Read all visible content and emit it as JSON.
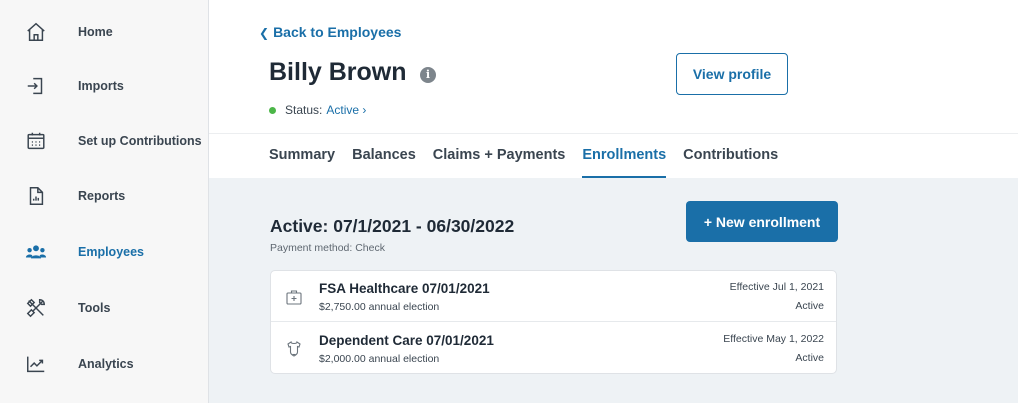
{
  "sidebar": {
    "items": [
      {
        "label": "Home",
        "icon": "home-icon"
      },
      {
        "label": "Imports",
        "icon": "import-icon"
      },
      {
        "label": "Set up Contributions",
        "icon": "calendar-icon"
      },
      {
        "label": "Reports",
        "icon": "report-document-icon"
      },
      {
        "label": "Employees",
        "icon": "people-icon",
        "active": true
      },
      {
        "label": "Tools",
        "icon": "tools-icon"
      },
      {
        "label": "Analytics",
        "icon": "analytics-icon"
      }
    ]
  },
  "header": {
    "back_label": "Back to Employees",
    "employee_name": "Billy Brown",
    "status_prefix": "Status:",
    "status_value": "Active ›",
    "view_profile_label": "View profile",
    "tabs": [
      {
        "label": "Summary"
      },
      {
        "label": "Balances"
      },
      {
        "label": "Claims + Payments"
      },
      {
        "label": "Enrollments",
        "active": true
      },
      {
        "label": "Contributions"
      }
    ]
  },
  "main": {
    "period_title": "Active: 07/1/2021 - 06/30/2022",
    "payment_method": "Payment method: Check",
    "new_enrollment_label": "+ New enrollment",
    "enrollments": [
      {
        "title": "FSA Healthcare 07/01/2021",
        "election": "$2,750.00 annual election",
        "effective": "Effective Jul 1, 2021",
        "status": "Active",
        "icon": "first-aid-kit-icon"
      },
      {
        "title": "Dependent Care 07/01/2021",
        "election": "$2,000.00 annual election",
        "effective": "Effective May 1, 2022",
        "status": "Active",
        "icon": "baby-onesie-icon"
      }
    ]
  },
  "colors": {
    "accent": "#1a6fa8",
    "status_active": "#4cb648",
    "sidebar_bg": "#f7f7f7",
    "content_bg": "#eef2f5"
  }
}
